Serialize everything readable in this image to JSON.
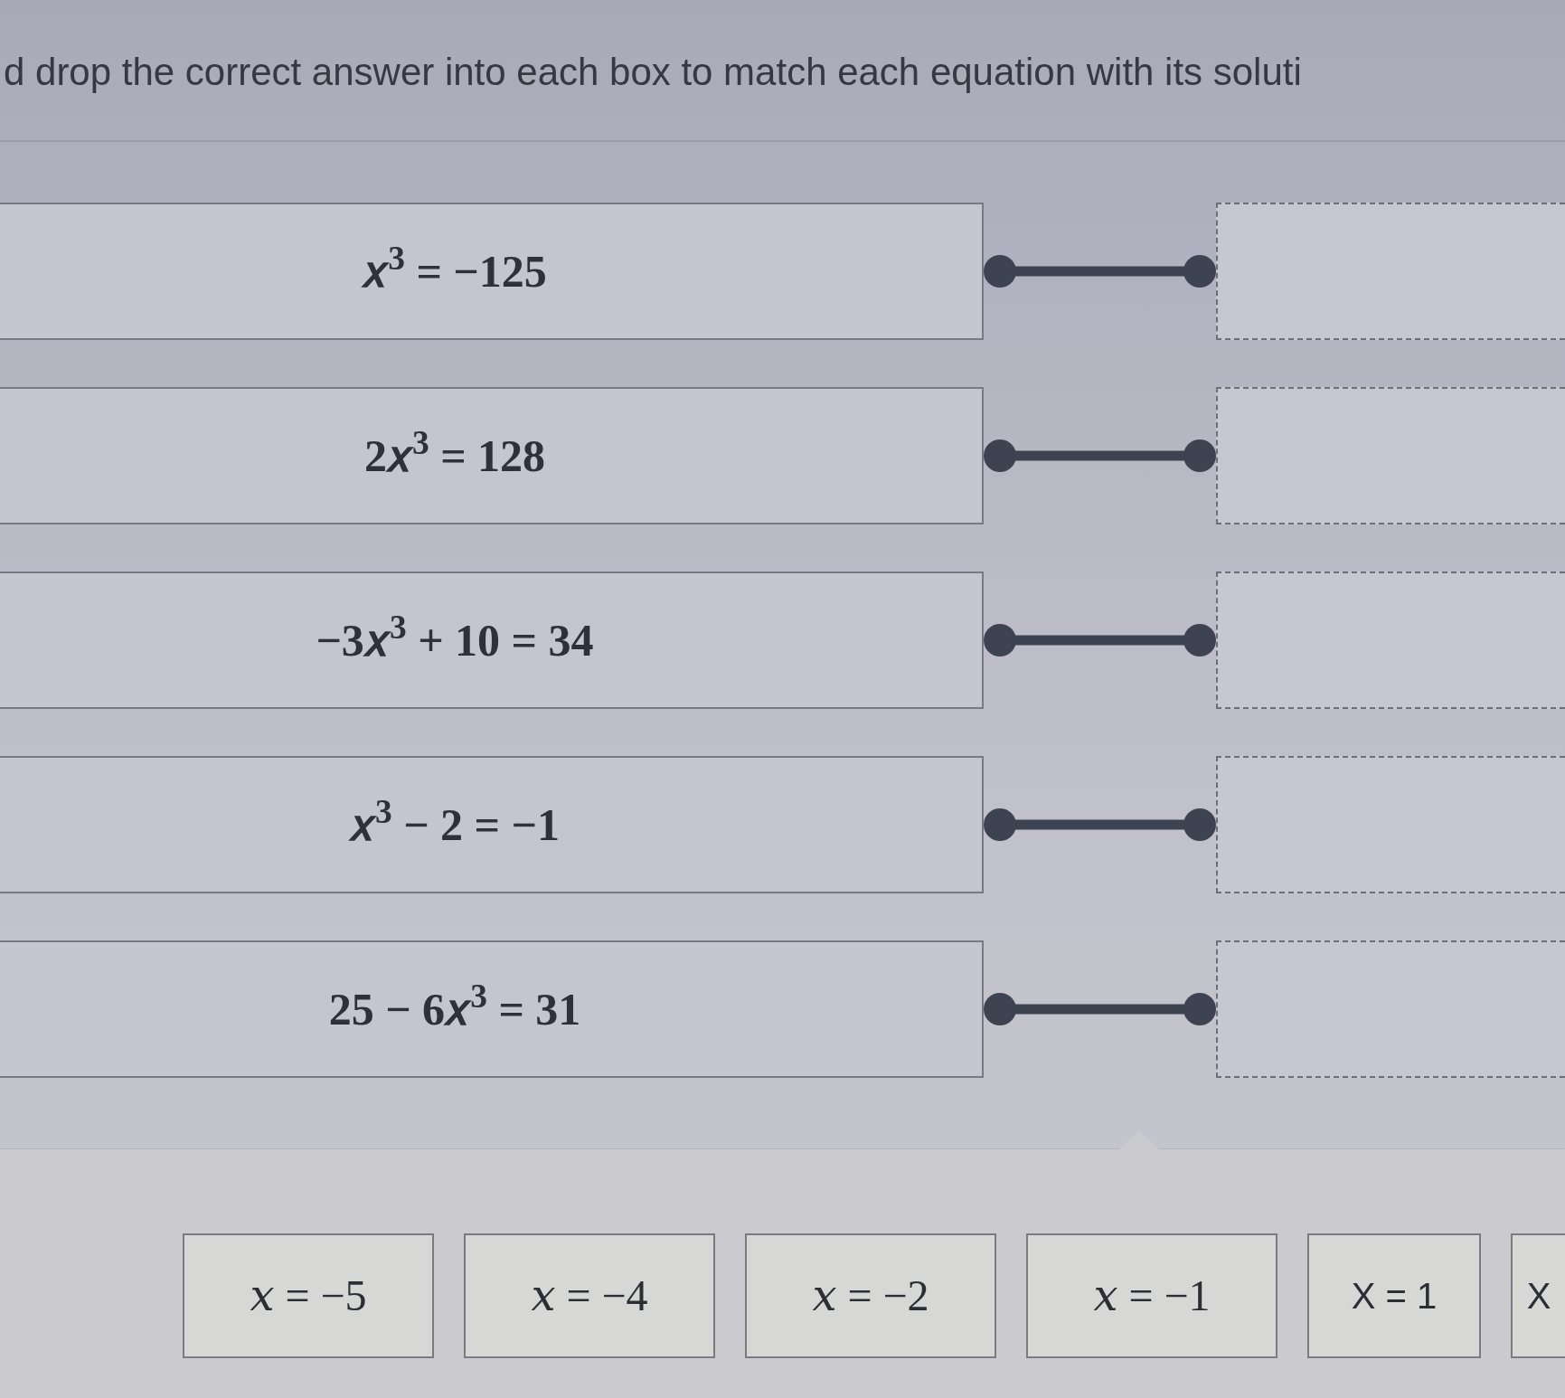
{
  "instruction": "d drop the correct answer into each box to match each equation with its soluti",
  "equations": [
    "𝑥$^{3}$ = −125",
    "2𝑥$^{3}$ = 128",
    "−3𝑥$^{3}$ + 10 = 34",
    "𝑥$^{3}$ − 2 = −1",
    "25 − 6𝑥$^{3}$ = 31"
  ],
  "answer_tiles": [
    {
      "kind": "math",
      "label": "𝑥 = −5"
    },
    {
      "kind": "math",
      "label": "𝑥 = −4"
    },
    {
      "kind": "math",
      "label": "𝑥 = −2"
    },
    {
      "kind": "math",
      "label": "𝑥 = −1"
    },
    {
      "kind": "text",
      "label": "X = 1"
    },
    {
      "kind": "text",
      "label": "X"
    }
  ]
}
